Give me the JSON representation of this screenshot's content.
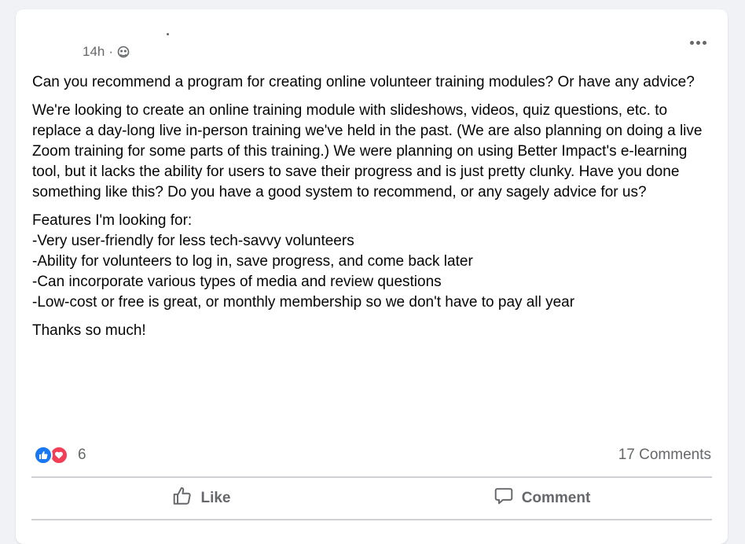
{
  "post": {
    "timestamp": "14h",
    "separator": "·",
    "privacy_icon": "globe-icon",
    "more_icon": "more-options-icon",
    "paragraphs": [
      "Can you recommend a program for creating online volunteer training modules? Or have any advice?",
      "We're looking to create an online training module with slideshows, videos, quiz questions, etc. to replace a day-long live in-person training we've held in the past. (We are also planning on doing a live Zoom training for some parts of this training.) We were planning on using Better Impact's e-learning tool, but it lacks the ability for users to save their progress and is just pretty clunky. Have you done something like this? Do you have a good system to recommend, or any sagely advice for us?",
      "Features I'm looking for:",
      "Thanks so much!"
    ],
    "features": [
      "-Very user-friendly for less tech-savvy volunteers",
      "-Ability for volunteers to log in, save progress, and come back later",
      "-Can incorporate various types of media and review questions",
      "-Low-cost or free is great, or monthly membership so we don't have to pay all year"
    ]
  },
  "engagement": {
    "reaction_count": "6",
    "comments_label": "17 Comments",
    "reaction_icons": [
      "like-reaction-icon",
      "love-reaction-icon"
    ]
  },
  "actions": {
    "like_label": "Like",
    "comment_label": "Comment"
  },
  "colors": {
    "like_blue": "#1877f2",
    "love_red": "#f33e58",
    "secondary_text": "#65676b"
  }
}
